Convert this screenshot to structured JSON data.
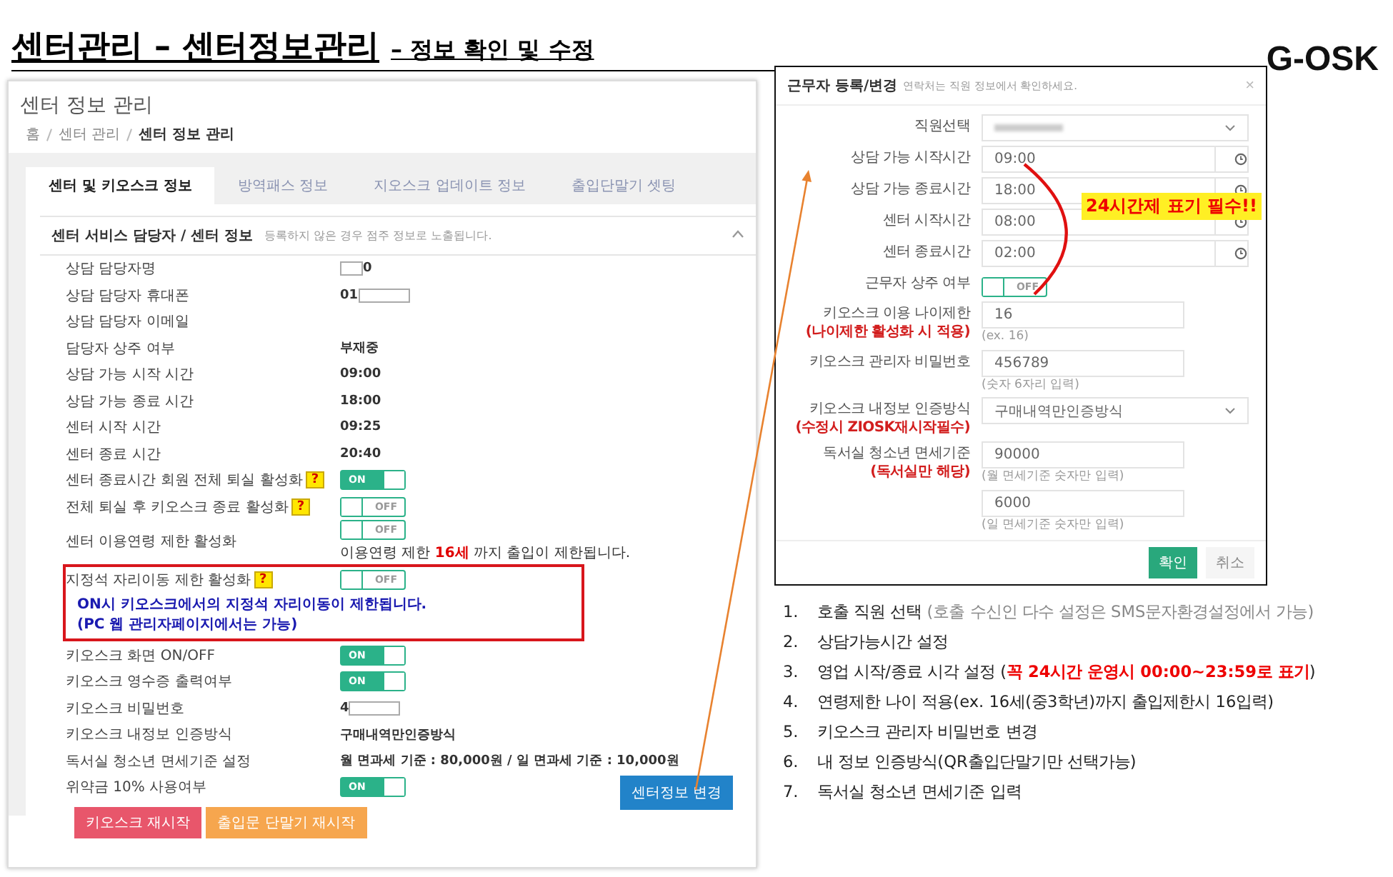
{
  "header": {
    "title": "센터관리 – 센터정보관리",
    "subtitle": "– 정보 확인 및 수정",
    "logo": "G-OSK"
  },
  "center_panel": {
    "title": "센터 정보 관리",
    "breadcrumb": [
      {
        "label": "홈",
        "current": false
      },
      {
        "label": "센터 관리",
        "current": false
      },
      {
        "label": "센터 정보 관리",
        "current": true
      }
    ],
    "tabs": [
      {
        "label": "센터 및 키오스크 정보",
        "selected": true
      },
      {
        "label": "방역패스 정보",
        "selected": false
      },
      {
        "label": "지오스크 업데이트 정보",
        "selected": false
      },
      {
        "label": "출입단말기 셋팅",
        "selected": false
      }
    ],
    "section": {
      "title": "센터 서비스 담당자 / 센터 정보",
      "note": "등록하지 않은 경우 점주 정보로 노출됩니다.",
      "expanded": true
    },
    "rows": [
      {
        "kind": "leadmask",
        "label": "상담 담당자명",
        "value": "0",
        "highlighted": false
      },
      {
        "kind": "tailmask",
        "label": "상담 담당자 휴대폰",
        "value": "01",
        "highlighted": false
      },
      {
        "kind": "text",
        "label": "상담 담당자 이메일",
        "highlighted": false
      },
      {
        "kind": "text",
        "label": "담당자 상주 여부",
        "value": "부재중",
        "highlighted": false
      },
      {
        "kind": "text",
        "label": "상담 가능 시작 시간",
        "value": "09:00",
        "highlighted": false
      },
      {
        "kind": "text",
        "label": "상담 가능 종료 시간",
        "value": "18:00",
        "highlighted": false
      },
      {
        "kind": "text",
        "label": "센터 시작 시간",
        "value": "09:25",
        "highlighted": false
      },
      {
        "kind": "text",
        "label": "센터 종료 시간",
        "value": "20:40",
        "highlighted": false
      },
      {
        "kind": "toggle",
        "label": "센터 종료시간 회원 전체 퇴실 활성화",
        "help": "?",
        "on": true,
        "state_label": "ON",
        "highlighted": false
      },
      {
        "kind": "toggle",
        "label": "전체 퇴실 후 키오스크 종료 활성화",
        "help": "?",
        "on": false,
        "state_label": "OFF",
        "highlighted": false
      },
      {
        "kind": "toggle",
        "label": "센터 이용연령 제한 활성화",
        "on": false,
        "state_label": "OFF",
        "note": "이용연령 제한 **16세** 까지 출입이 제한됩니다.",
        "highlighted": false
      },
      {
        "kind": "toggle",
        "label": "지정석 자리이동 제한 활성화",
        "help": "?",
        "on": false,
        "state_label": "OFF",
        "highlighted": true,
        "annotation": [
          "ON시 키오스크에서의 지정석 자리이동이 제한됩니다.",
          "(PC 웹 관리자페이지에서는 가능)"
        ]
      },
      {
        "kind": "toggle",
        "label": "키오스크 화면 ON/OFF",
        "on": true,
        "state_label": "ON",
        "highlighted": false
      },
      {
        "kind": "toggle",
        "label": "키오스크 영수증 출력여부",
        "on": true,
        "state_label": "ON",
        "highlighted": false
      },
      {
        "kind": "tailmask",
        "label": "키오스크 비밀번호",
        "value": "4",
        "highlighted": false
      },
      {
        "kind": "text",
        "label": "키오스크 내정보 인증방식",
        "value": "구매내역만인증방식",
        "highlighted": false
      },
      {
        "kind": "text",
        "label": "독서실 청소년 면세기준 설정",
        "value": "월 면과세 기준 : 80,000원 / 일 면과세 기준 : 10,000원",
        "highlighted": false
      },
      {
        "kind": "toggle",
        "label": "위약금 10% 사용여부",
        "on": true,
        "state_label": "ON",
        "highlighted": false
      }
    ],
    "buttons": [
      {
        "label": "키오스크 재시작",
        "kind": "danger"
      },
      {
        "label": "출입문 단말기 재시작",
        "kind": "warning"
      }
    ],
    "submit": {
      "label": "센터정보 변경"
    }
  },
  "worker_dialog": {
    "title": "근무자 등록/변경",
    "subtitle": "연락처는 직원 정보에서 확인하세요.",
    "close": "×",
    "fields": [
      {
        "kind": "select",
        "label": "직원선택",
        "redacted": true
      },
      {
        "kind": "time",
        "label": "상담 가능 시작시간",
        "value": "09:00"
      },
      {
        "kind": "time",
        "label": "상담 가능 종료시간",
        "value": "18:00"
      },
      {
        "kind": "time",
        "label": "센터 시작시간",
        "value": "08:00"
      },
      {
        "kind": "time",
        "label": "센터 종료시간",
        "value": "02:00"
      },
      {
        "kind": "toggle",
        "label": "근무자 상주 여부",
        "on": false,
        "state_label": "OFF"
      },
      {
        "kind": "input",
        "label": "키오스크 이용 나이제한",
        "sublabel": "(나이제한 활성화 시 적용)",
        "value": "16",
        "hint": "(ex. 16)"
      },
      {
        "kind": "input",
        "label": "키오스크 관리자 비밀번호",
        "value": "456789",
        "hint": "(숫자 6자리 입력)"
      },
      {
        "kind": "select",
        "label": "키오스크 내정보 인증방식",
        "sublabel": "(수정시 ZIOSK재시작필수)",
        "value": "구매내역만인증방식",
        "redacted": false
      },
      {
        "kind": "input",
        "label": "독서실 청소년 면세기준",
        "sublabel": "(독서실만 해당)",
        "value": "90000",
        "hint": "(월 면세기준 숫자만 입력)"
      },
      {
        "kind": "input",
        "value": "6000",
        "hint": "(일 면세기준 숫자만 입력)"
      }
    ],
    "callout": "24시간제 표기 필수!!",
    "buttons": [
      {
        "label": "확인",
        "kind": "primary"
      },
      {
        "label": "취소",
        "kind": "secondary"
      }
    ]
  },
  "guide": {
    "items": [
      {
        "number": "1.",
        "parts": [
          {
            "text": "호출 직원 선택 ",
            "kind": "plain"
          },
          {
            "text": "(호출 수신인 다수 설정은 SMS문자환경설정에서 가능)",
            "kind": "muted"
          }
        ]
      },
      {
        "number": "2.",
        "parts": [
          {
            "text": "상담가능시간 설정",
            "kind": "plain"
          }
        ]
      },
      {
        "number": "3.",
        "parts": [
          {
            "text": "영업 시작/종료 시각 설정 (",
            "kind": "plain"
          },
          {
            "text": "꼭 24시간 운영시 00:00~23:59로 표기",
            "kind": "alert"
          },
          {
            "text": ")",
            "kind": "plain"
          }
        ]
      },
      {
        "number": "4.",
        "parts": [
          {
            "text": "연령제한 나이 적용(ex. 16세(중3학년)까지 출입제한시 16입력)",
            "kind": "plain"
          }
        ]
      },
      {
        "number": "5.",
        "parts": [
          {
            "text": "키오스크 관리자 비밀번호 변경",
            "kind": "plain"
          }
        ]
      },
      {
        "number": "6.",
        "parts": [
          {
            "text": "내 정보 인증방식(QR출입단말기만 선택가능)",
            "kind": "plain"
          }
        ]
      },
      {
        "number": "7.",
        "parts": [
          {
            "text": "독서실 청소년 면세기준 입력",
            "kind": "plain"
          }
        ]
      }
    ]
  }
}
